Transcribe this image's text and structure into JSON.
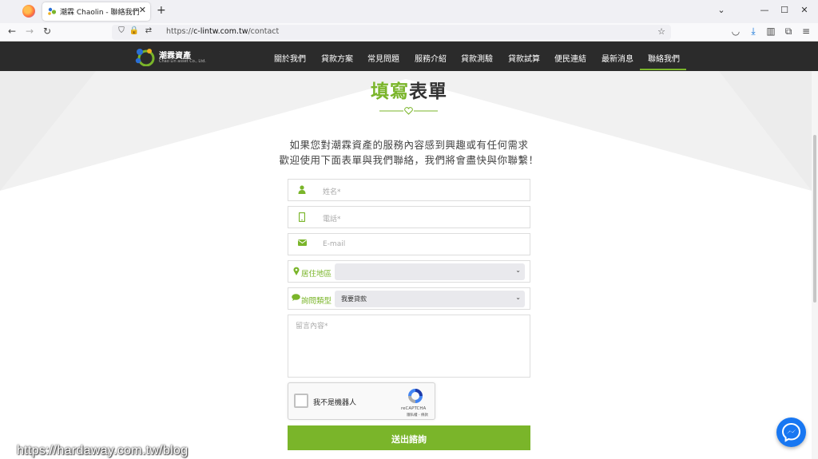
{
  "browser": {
    "tab_title": "潮霖 Chaolin - 聯絡我們",
    "url_prefix": "https://",
    "url_host": "c-lintw.com.tw",
    "url_path": "/contact"
  },
  "site": {
    "logo_name": "潮霖資產",
    "logo_sub": "Chao Lin asset Co., Ltd.",
    "menu": [
      "關於我們",
      "貸款方案",
      "常見問題",
      "服務介紹",
      "貸款測驗",
      "貸款試算",
      "便民連結",
      "最新消息",
      "聯絡我們"
    ],
    "active_menu": "聯絡我們",
    "accent_color": "#7ab52a"
  },
  "form": {
    "title_green": "填寫",
    "title_dark": "表單",
    "intro_line1": "如果您對潮霖資產的服務內容感到興趣或有任何需求",
    "intro_line2": "歡迎使用下面表單與我們聯絡，我們將會盡快與你聯繫！",
    "name_placeholder": "姓名*",
    "phone_placeholder": "電話*",
    "email_placeholder": "E-mail",
    "area_label": "居住地區",
    "area_value": "",
    "inquiry_label": "詢問類型",
    "inquiry_value": "我要貸款",
    "message_placeholder": "留言內容*",
    "submit_label": "送出諮詢"
  },
  "recaptcha": {
    "label": "我不是機器人",
    "brand": "reCAPTCHA",
    "terms": "隱私權 - 條款"
  },
  "watermark": "https://hardaway.com.tw/blog"
}
